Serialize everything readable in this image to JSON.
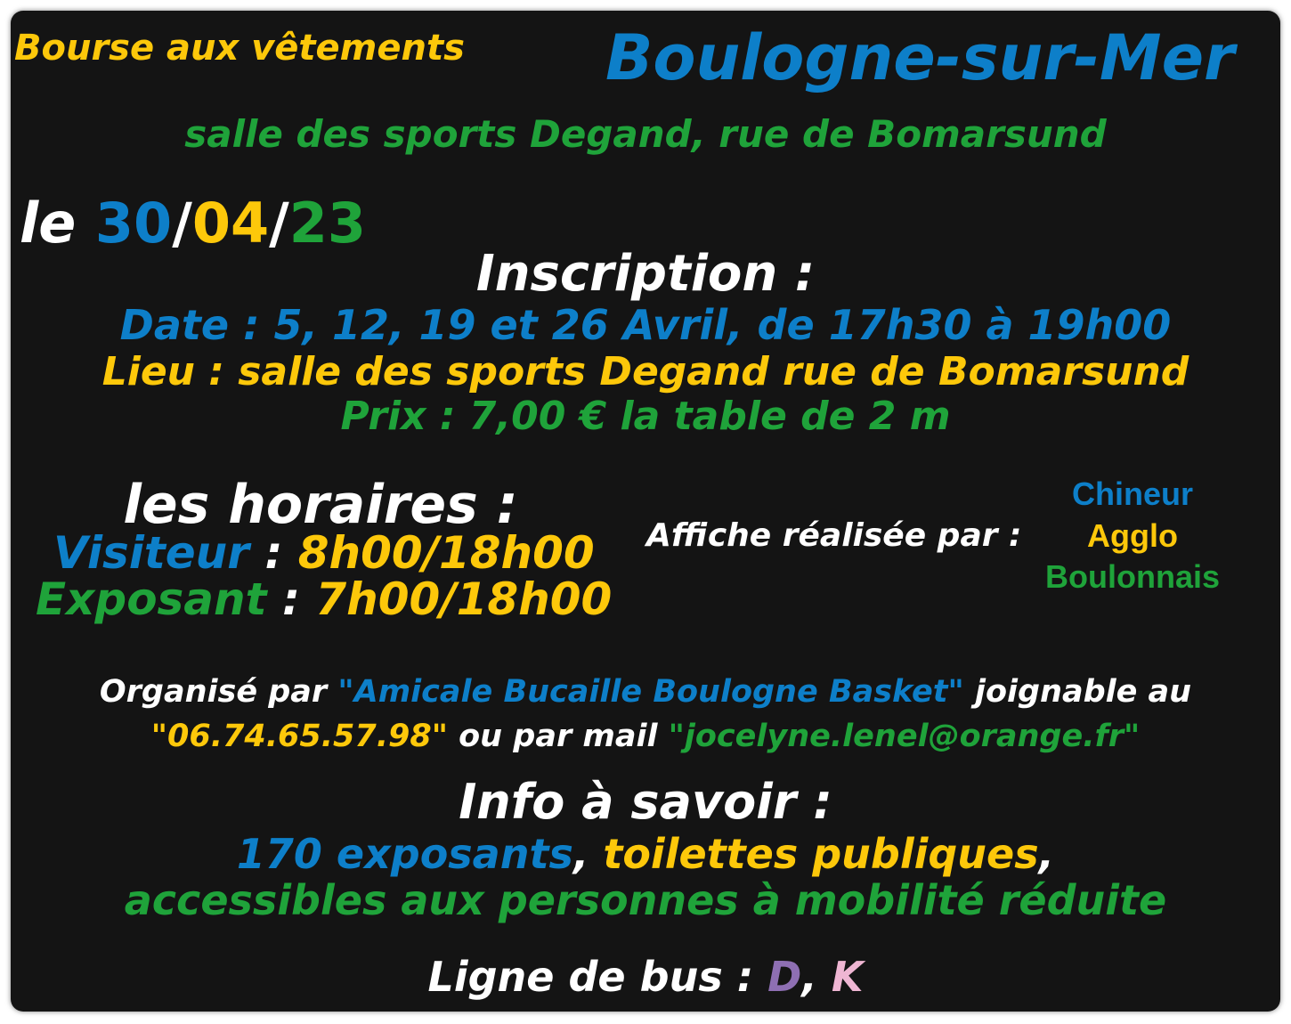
{
  "header": {
    "event_type": "Bourse aux vêtements",
    "city": "Boulogne-sur-Mer",
    "venue": "salle des sports Degand, rue de Bomarsund"
  },
  "date": {
    "prefix": "le",
    "day": "30",
    "sep1": "/",
    "month": "04",
    "sep2": "/",
    "year": "23"
  },
  "inscription": {
    "title": "Inscription :",
    "date_line": "Date : 5, 12, 19 et 26 Avril, de 17h30 à 19h00",
    "place_line": "Lieu : salle des sports Degand rue de Bomarsund",
    "price_line": "Prix : 7,00 € la table de 2 m"
  },
  "hours": {
    "title": "les horaires :",
    "visitor_label": "Visiteur",
    "visitor_sep": " : ",
    "visitor_time": "8h00/18h00",
    "exhibitor_label": "Exposant",
    "exhibitor_sep": " : ",
    "exhibitor_time": "7h00/18h00"
  },
  "credits": {
    "label": "Affiche réalisée par :",
    "line1": "Chineur",
    "line2": "Agglo",
    "line3": "Boulonnais"
  },
  "organizer": {
    "prefix": "Organisé par ",
    "name": "\"Amicale Bucaille Boulogne Basket\"",
    "mid": " joignable au",
    "phone": "\"06.74.65.57.98\"",
    "mail_prefix": " ou par mail ",
    "email": "\"jocelyne.lenel@orange.fr\""
  },
  "info": {
    "title": "Info à savoir :",
    "exhibitors": "170 exposants",
    "comma1": ", ",
    "toilets": "toilettes publiques",
    "comma2": ",",
    "accessibility": "accessibles aux personnes à mobilité réduite"
  },
  "bus": {
    "label": "Ligne de bus : ",
    "line_d": "D",
    "comma": ", ",
    "line_k": "K"
  },
  "colors": {
    "blue": "#0d7fc9",
    "yellow": "#fdc80a",
    "green": "#1fa33a",
    "white": "#ffffff",
    "purple": "#8e6fb3",
    "pink": "#efb6d3",
    "background": "#141414"
  }
}
